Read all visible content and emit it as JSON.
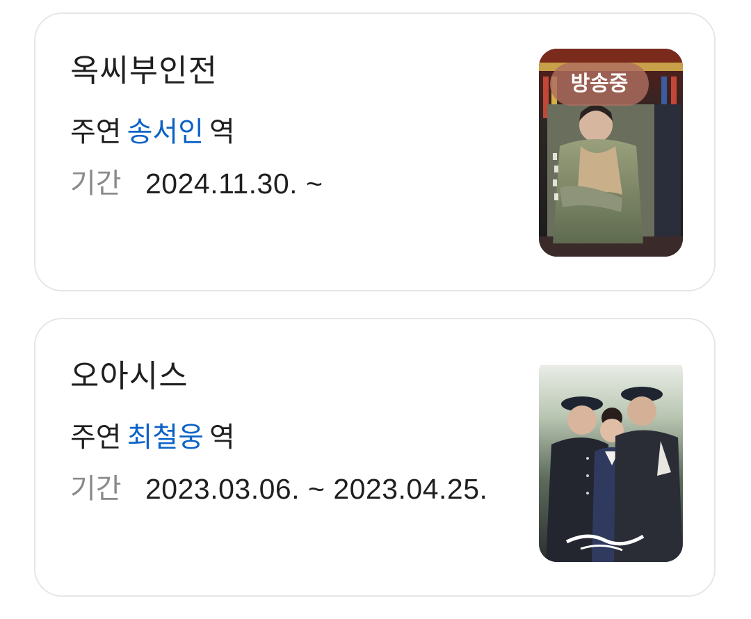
{
  "items": [
    {
      "title": "옥씨부인전",
      "role_prefix": "주연",
      "actor": "송서인",
      "role_suffix": "역",
      "period_label": "기간",
      "period_value": "2024.11.30. ~",
      "badge": "방송중",
      "poster_icon": "drama-poster-image"
    },
    {
      "title": "오아시스",
      "role_prefix": "주연",
      "actor": "최철웅",
      "role_suffix": "역",
      "period_label": "기간",
      "period_value": "2023.03.06. ~ 2023.04.25.",
      "poster_icon": "drama-poster-image"
    }
  ],
  "colors": {
    "link": "#0b63c6",
    "muted": "#8a8a8a",
    "text": "#1f1f1f",
    "border": "#e6e6e6",
    "badge_bg": "#af6e5f"
  }
}
